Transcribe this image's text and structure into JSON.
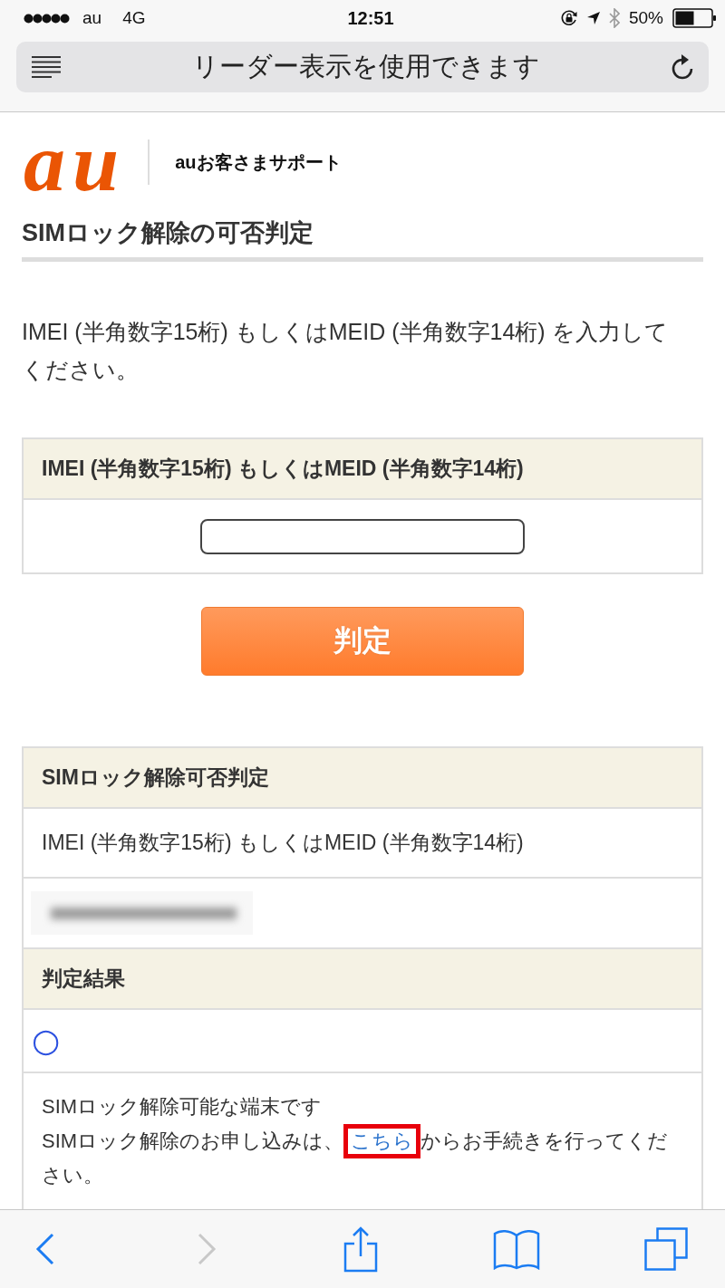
{
  "status_bar": {
    "carrier": "au",
    "network": "4G",
    "time": "12:51",
    "battery": "50%"
  },
  "browser_bar": {
    "address_text": "リーダー表示を使用できます"
  },
  "header": {
    "logo": "au",
    "site_name": "auお客さまサポート"
  },
  "page_title": "SIMロック解除の可否判定",
  "instruction": "IMEI (半角数字15桁) もしくはMEID (半角数字14桁) を入力してください。",
  "input_form": {
    "label": "IMEI (半角数字15桁) もしくはMEID (半角数字14桁)",
    "submit_button": "判定"
  },
  "result_table": {
    "rows": [
      {
        "kind": "header",
        "text": "SIMロック解除可否判定"
      },
      {
        "kind": "text",
        "text": "IMEI (半角数字15桁) もしくはMEID (半角数字14桁)"
      },
      {
        "kind": "redacted"
      },
      {
        "kind": "header",
        "text": "判定結果"
      },
      {
        "kind": "mark",
        "text": "○"
      },
      {
        "kind": "message",
        "line_1": "SIMロック解除可能な端末です",
        "before_link": "SIMロック解除のお申し込みは、",
        "link": {
          "text": "こちら",
          "highlighted": true
        },
        "after_link": "からお手続きを行ってください。"
      }
    ]
  },
  "toolbar": [
    {
      "kind": "back",
      "disabled": false
    },
    {
      "kind": "forward",
      "disabled": true
    },
    {
      "kind": "share",
      "disabled": false
    },
    {
      "kind": "bookmarks",
      "disabled": false
    },
    {
      "kind": "tabs",
      "disabled": false
    }
  ]
}
